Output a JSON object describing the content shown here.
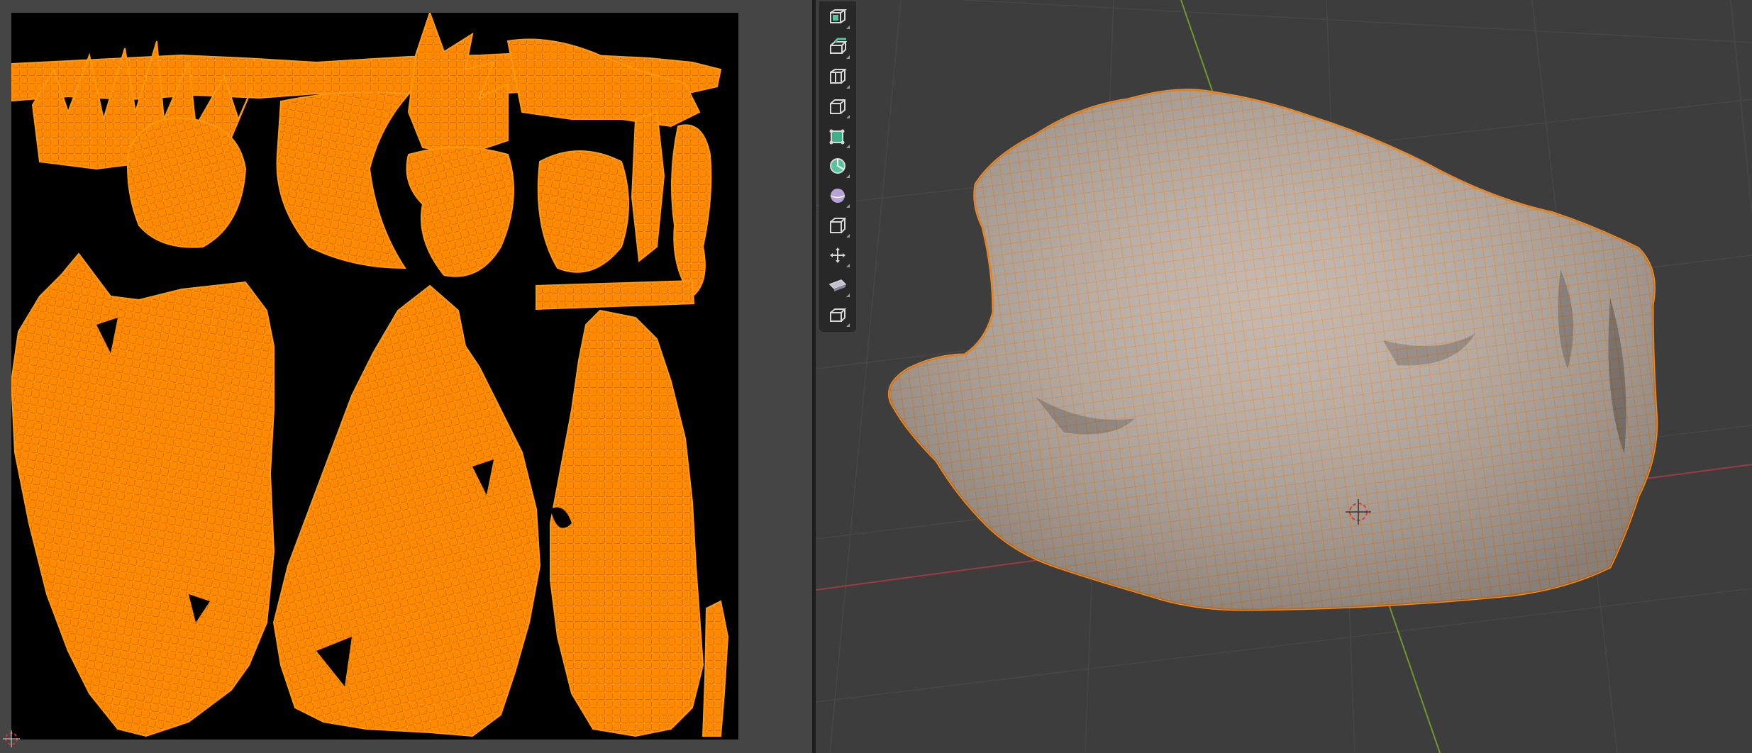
{
  "window": {
    "left_editor": "uv-editor",
    "right_editor": "3d-viewport"
  },
  "colors": {
    "uv_background": "#000000",
    "uv_island": "#ff8a00",
    "uv_vertex": "#ff9a10",
    "editor_background": "#454545",
    "viewport_background": "#3d3d3d",
    "grid_line": "#4a4a4a",
    "x_axis": "#9a3b45",
    "y_axis": "#6d9a2a",
    "mesh_surface": "#b8aba1",
    "mesh_wire": "#f08a24",
    "toolbar_bg": "#282828",
    "tool_active": "#5a7f9a"
  },
  "toolbar": {
    "tools": [
      {
        "name": "select-box-icon",
        "icon": "cube-select"
      },
      {
        "name": "extrude-region-icon",
        "icon": "cube-extrude"
      },
      {
        "name": "inset-faces-icon",
        "icon": "cube-inset"
      },
      {
        "name": "bevel-icon",
        "icon": "cube-bevel"
      },
      {
        "name": "loop-cut-icon",
        "icon": "cube-loopcut"
      },
      {
        "name": "knife-icon",
        "icon": "knife"
      },
      {
        "name": "poly-build-icon",
        "icon": "sphere"
      },
      {
        "name": "spin-icon",
        "icon": "cube-spin"
      },
      {
        "name": "move-icon",
        "icon": "move-arrows"
      },
      {
        "name": "shear-icon",
        "icon": "shear"
      },
      {
        "name": "rip-region-icon",
        "icon": "cube-rip"
      }
    ]
  }
}
